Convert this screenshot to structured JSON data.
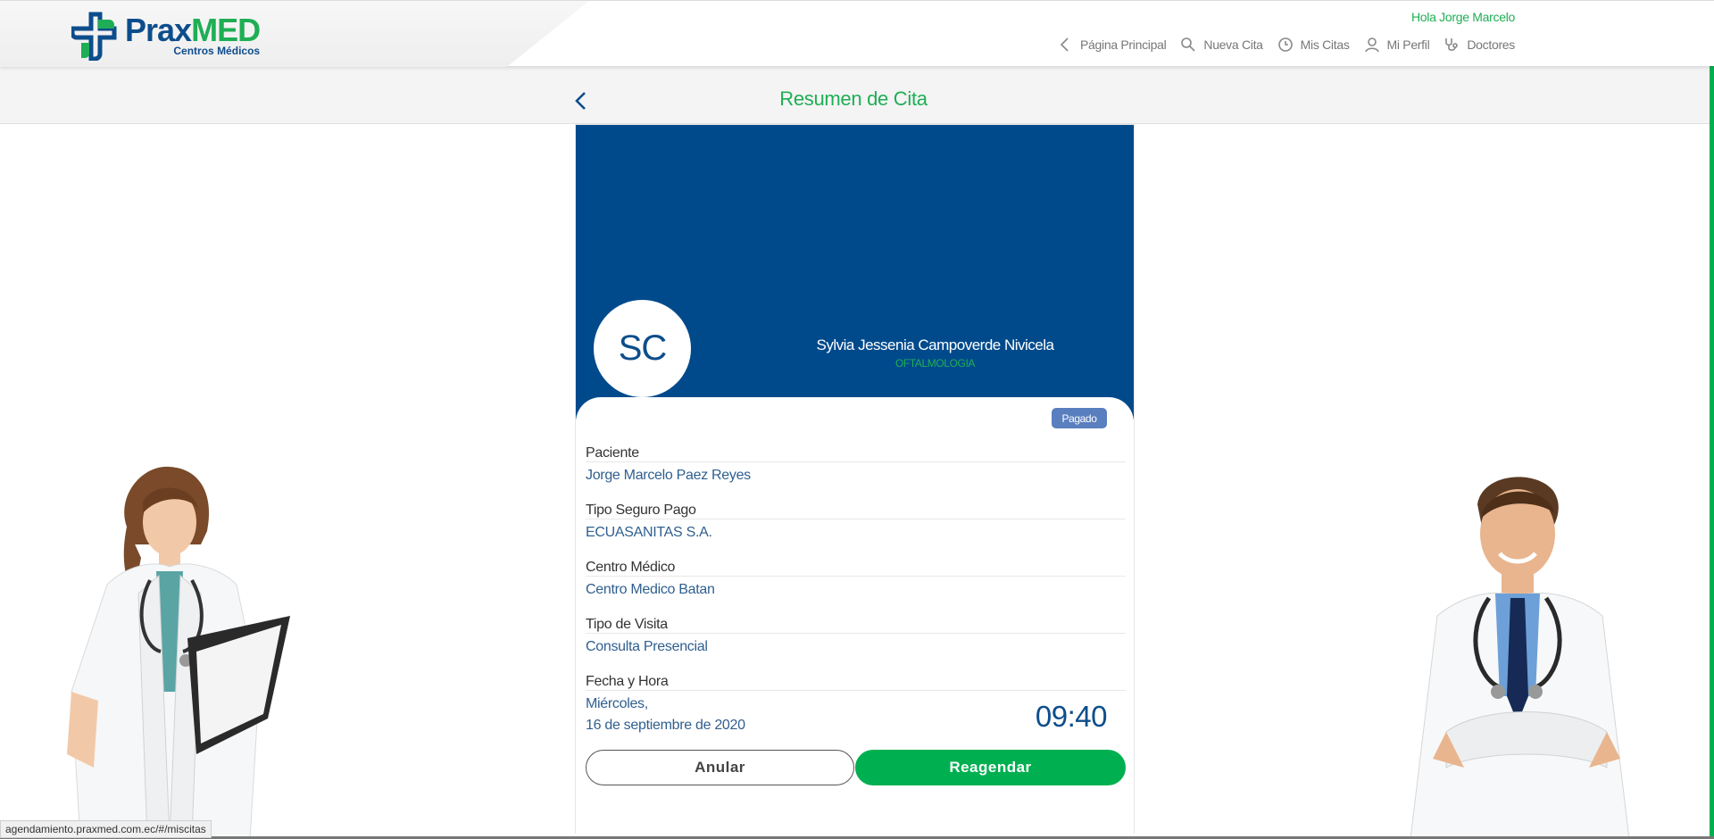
{
  "header": {
    "brand_left": "Prax",
    "brand_right": "MED",
    "brand_sub": "Centros Médicos",
    "greeting": "Hola Jorge Marcelo",
    "nav": [
      {
        "label": "Página Principal",
        "icon": "chevron-left-icon"
      },
      {
        "label": "Nueva Cita",
        "icon": "search-icon"
      },
      {
        "label": "Mis Citas",
        "icon": "clock-icon"
      },
      {
        "label": "Mi Perfil",
        "icon": "user-icon"
      },
      {
        "label": "Doctores",
        "icon": "stethoscope-icon"
      }
    ]
  },
  "page": {
    "title": "Resumen de Cita"
  },
  "doctor": {
    "initials": "SC",
    "name": "Sylvia Jessenia Campoverde Nivicela",
    "specialty": "OFTALMOLOGIA"
  },
  "appointment": {
    "status": "Pagado",
    "fields": [
      {
        "label": "Paciente",
        "value": "Jorge Marcelo Paez Reyes"
      },
      {
        "label": "Tipo Seguro Pago",
        "value": "ECUASANITAS S.A."
      },
      {
        "label": "Centro Médico",
        "value": "Centro Medico Batan"
      },
      {
        "label": "Tipo de Visita",
        "value": "Consulta Presencial"
      }
    ],
    "date_label": "Fecha y Hora",
    "date_day": "Miércoles,",
    "date_full": "16 de septiembre de 2020",
    "time": "09:40"
  },
  "actions": {
    "cancel": "Anular",
    "reschedule": "Reagendar"
  },
  "status_bar": {
    "url": "agendamiento.praxmed.com.ec/#/miscitas"
  },
  "colors": {
    "brand_blue": "#0d4d8c",
    "brand_green": "#1fae55",
    "hero": "#004a8c",
    "badge": "#5a7fbf",
    "button_green": "#00b050"
  }
}
